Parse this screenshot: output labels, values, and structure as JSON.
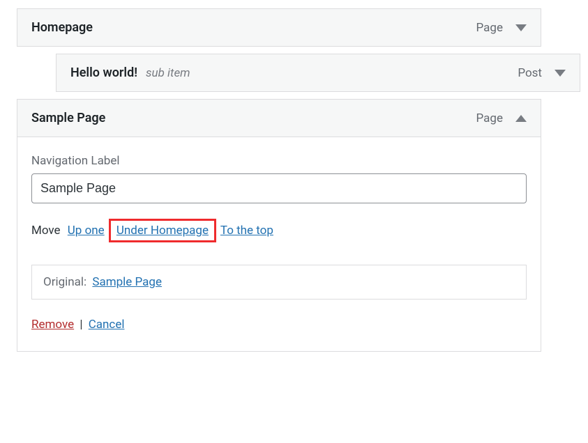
{
  "items": [
    {
      "title": "Homepage",
      "type": "Page",
      "expanded": false,
      "indent": false
    },
    {
      "title": "Hello world!",
      "sub_label": "sub item",
      "type": "Post",
      "expanded": false,
      "indent": true
    },
    {
      "title": "Sample Page",
      "type": "Page",
      "expanded": true,
      "indent": false
    }
  ],
  "editor": {
    "nav_label_text": "Navigation Label",
    "nav_label_value": "Sample Page",
    "move_label": "Move",
    "move_up": "Up one",
    "move_under": "Under Homepage",
    "move_top": "To the top",
    "original_label": "Original:",
    "original_link": "Sample Page",
    "remove": "Remove",
    "divider": "|",
    "cancel": "Cancel"
  }
}
